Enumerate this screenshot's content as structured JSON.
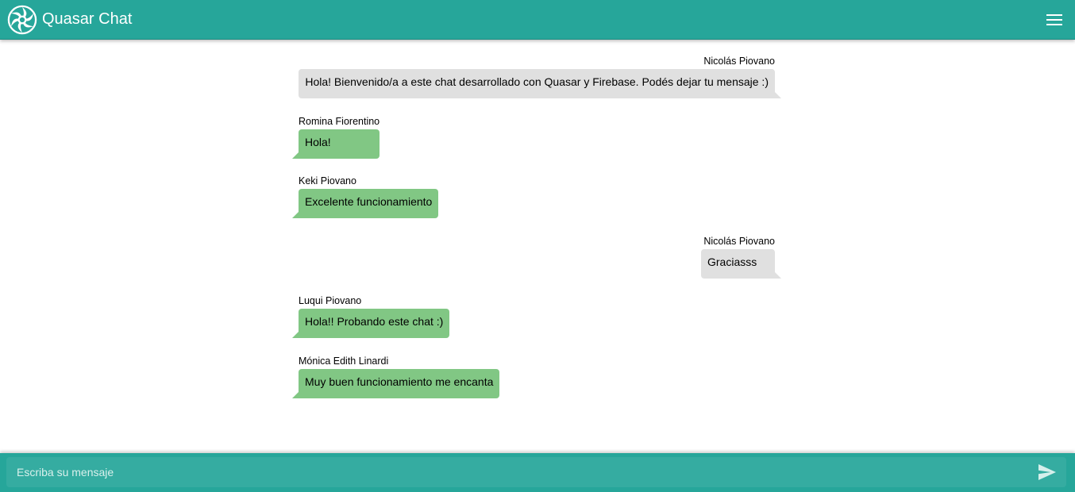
{
  "header": {
    "title": "Quasar Chat",
    "logo_icon": "quasar-logo-icon",
    "menu_icon": "hamburger-menu-icon",
    "color": "#26a69a"
  },
  "messages": [
    {
      "author": "Nicolás Piovano",
      "text": "Hola! Bienvenido/a a este chat desarrollado con Quasar y Firebase. Podés dejar tu mensaje :)",
      "sent": true
    },
    {
      "author": "Romina Fiorentino",
      "text": "Hola!",
      "sent": false
    },
    {
      "author": "Keki Piovano",
      "text": "Excelente funcionamiento",
      "sent": false
    },
    {
      "author": "Nicolás Piovano",
      "text": "Graciasss",
      "sent": true
    },
    {
      "author": "Luqui Piovano",
      "text": "Hola!! Probando este chat :)",
      "sent": false
    },
    {
      "author": "Mónica Edith Linardi",
      "text": "Muy buen funcionamiento me encanta",
      "sent": false
    }
  ],
  "colors": {
    "sent_bubble": "#e0e0e0",
    "received_bubble": "#81c784"
  },
  "composer": {
    "placeholder": "Escriba su mensaje",
    "value": "",
    "send_icon": "send-icon"
  }
}
